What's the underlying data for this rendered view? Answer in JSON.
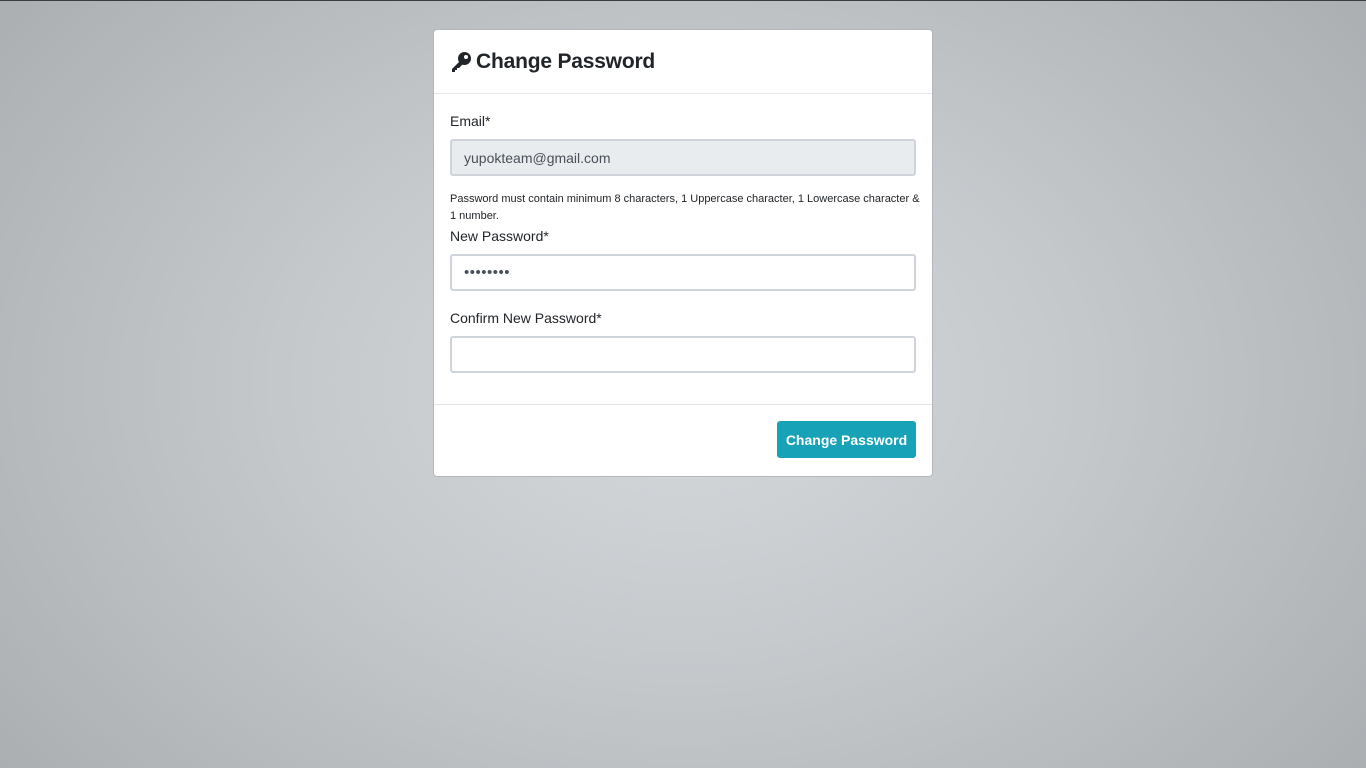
{
  "card": {
    "title": "Change Password",
    "icon": "key-icon"
  },
  "form": {
    "email_label": "Email*",
    "email_value": "yupokteam@gmail.com",
    "password_hint": "Password must contain minimum 8 characters, 1 Uppercase character, 1 Lowercase character & 1 number.",
    "new_password_label": "New Password*",
    "new_password_value": "••••••••",
    "confirm_password_label": "Confirm New Password*",
    "confirm_password_value": "",
    "submit_label": "Change Password"
  },
  "colors": {
    "accent": "#17a2b8",
    "disabled_input_bg": "#e9ecef"
  }
}
